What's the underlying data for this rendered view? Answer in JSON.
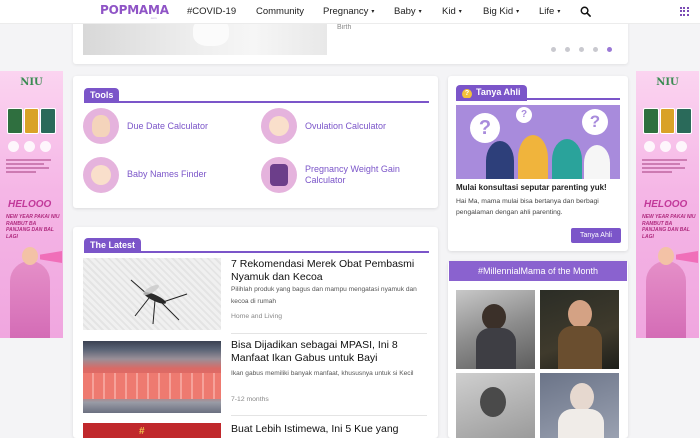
{
  "header": {
    "logo": "POPMAMA",
    "logo_sub": ".com",
    "nav": [
      {
        "label": "#COVID-19",
        "dropdown": false
      },
      {
        "label": "Community",
        "dropdown": false
      },
      {
        "label": "Pregnancy",
        "dropdown": true
      },
      {
        "label": "Baby",
        "dropdown": true
      },
      {
        "label": "Kid",
        "dropdown": true
      },
      {
        "label": "Big Kid",
        "dropdown": true
      },
      {
        "label": "Life",
        "dropdown": true
      }
    ],
    "caret": "▾"
  },
  "slider": {
    "caption": "Birth",
    "dot_count": 5,
    "active_dot": 5
  },
  "ads": {
    "brand": "NIU",
    "hello": "HELOOO",
    "promo": "NEW YEAR PAKAI NIU RAMBUT BA PANJANG DAN BAL LAGI",
    "image": "niu-hair-advertisement"
  },
  "tools": {
    "title": "Tools",
    "items": [
      {
        "label": "Due Date Calculator",
        "icon": "pregnant-woman-icon"
      },
      {
        "label": "Ovulation Calculator",
        "icon": "ovum-icon"
      },
      {
        "label": "Baby Names Finder",
        "icon": "baby-icon"
      },
      {
        "label": "Pregnancy Weight Gain Calculator",
        "icon": "weighing-scale-icon"
      }
    ]
  },
  "tanya": {
    "title": "Tanya Ahli",
    "badge": "?",
    "headline": "Mulai konsultasi seputar parenting yuk!",
    "description": "Hai Ma, mama mulai bisa bertanya dan berbagi pengalaman dengan ahli parenting.",
    "button": "Tanya Ahli"
  },
  "millennial": {
    "title": "#MillennialMama of the Month"
  },
  "latest": {
    "title": "The Latest",
    "articles": [
      {
        "title": "7 Rekomendasi Merek Obat Pembasmi Nyamuk dan Kecoa",
        "desc": "Pilihlah produk yang bagus dan mampu mengatasi nyamuk dan kecoa di rumah",
        "category": "Home and Living"
      },
      {
        "title": "Bisa Dijadikan sebagai MPASI, Ini 8 Manfaat Ikan Gabus untuk Bayi",
        "desc": "Ikan gabus memiliki banyak manfaat, khususnya untuk si Kecil",
        "category": "7-12 months"
      },
      {
        "title": "Buat Lebih Istimewa, Ini 5 Kue yang",
        "desc": "",
        "category": ""
      }
    ]
  },
  "colors": {
    "brand_purple": "#7b55c9",
    "logo_purple": "#8f54c6",
    "ad_pink": "#f5b6e6"
  }
}
